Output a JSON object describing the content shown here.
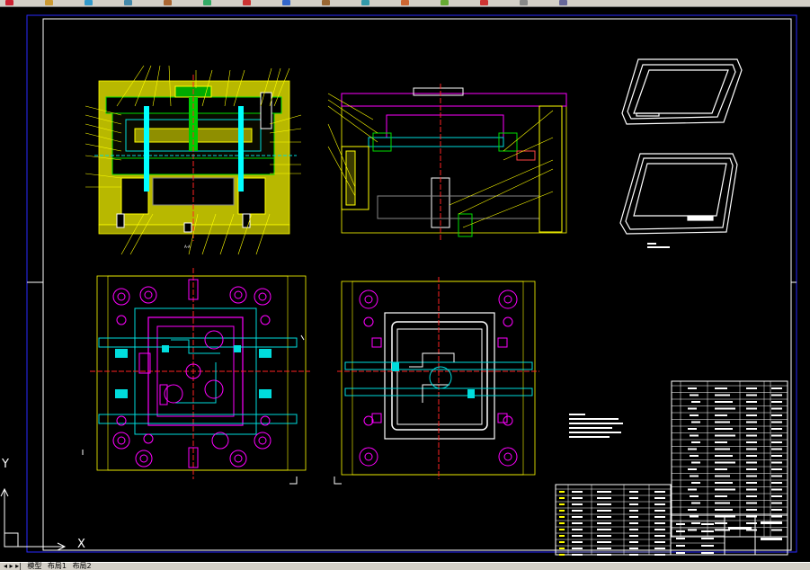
{
  "toolbar": {
    "buttons": [
      {
        "icon": "layer-icon",
        "color": "#c23"
      },
      {
        "icon": "properties-icon",
        "color": "#c93"
      },
      {
        "icon": "match-icon",
        "color": "#39c"
      },
      {
        "icon": "undo-icon",
        "color": "#48a"
      },
      {
        "icon": "redo-icon",
        "color": "#a63"
      },
      {
        "icon": "pan-icon",
        "color": "#3a6"
      },
      {
        "icon": "zoom-icon",
        "color": "#c33"
      },
      {
        "icon": "zoom-window-icon",
        "color": "#36c"
      },
      {
        "icon": "zoom-previous-icon",
        "color": "#963"
      },
      {
        "icon": "properties2-icon",
        "color": "#39a"
      },
      {
        "icon": "design-center-icon",
        "color": "#c63"
      },
      {
        "icon": "tool-palette-icon",
        "color": "#6a3"
      },
      {
        "icon": "markup-icon",
        "color": "#c33"
      },
      {
        "icon": "calc-icon",
        "color": "#888"
      },
      {
        "icon": "help-icon",
        "color": "#669"
      }
    ]
  },
  "tabs": {
    "model": "模型",
    "layout1": "布局1",
    "layout2": "布局2"
  },
  "ucs": {
    "y": "Y",
    "x": "X"
  },
  "colors": {
    "background": "#000000",
    "border": "#2a2aff",
    "frame": "#ffffff",
    "mold_yellow": "#c8c800",
    "mold_green": "#00d000",
    "mold_cyan": "#00d0d0",
    "mold_magenta": "#ff00ff",
    "red_center": "#ff2020"
  }
}
